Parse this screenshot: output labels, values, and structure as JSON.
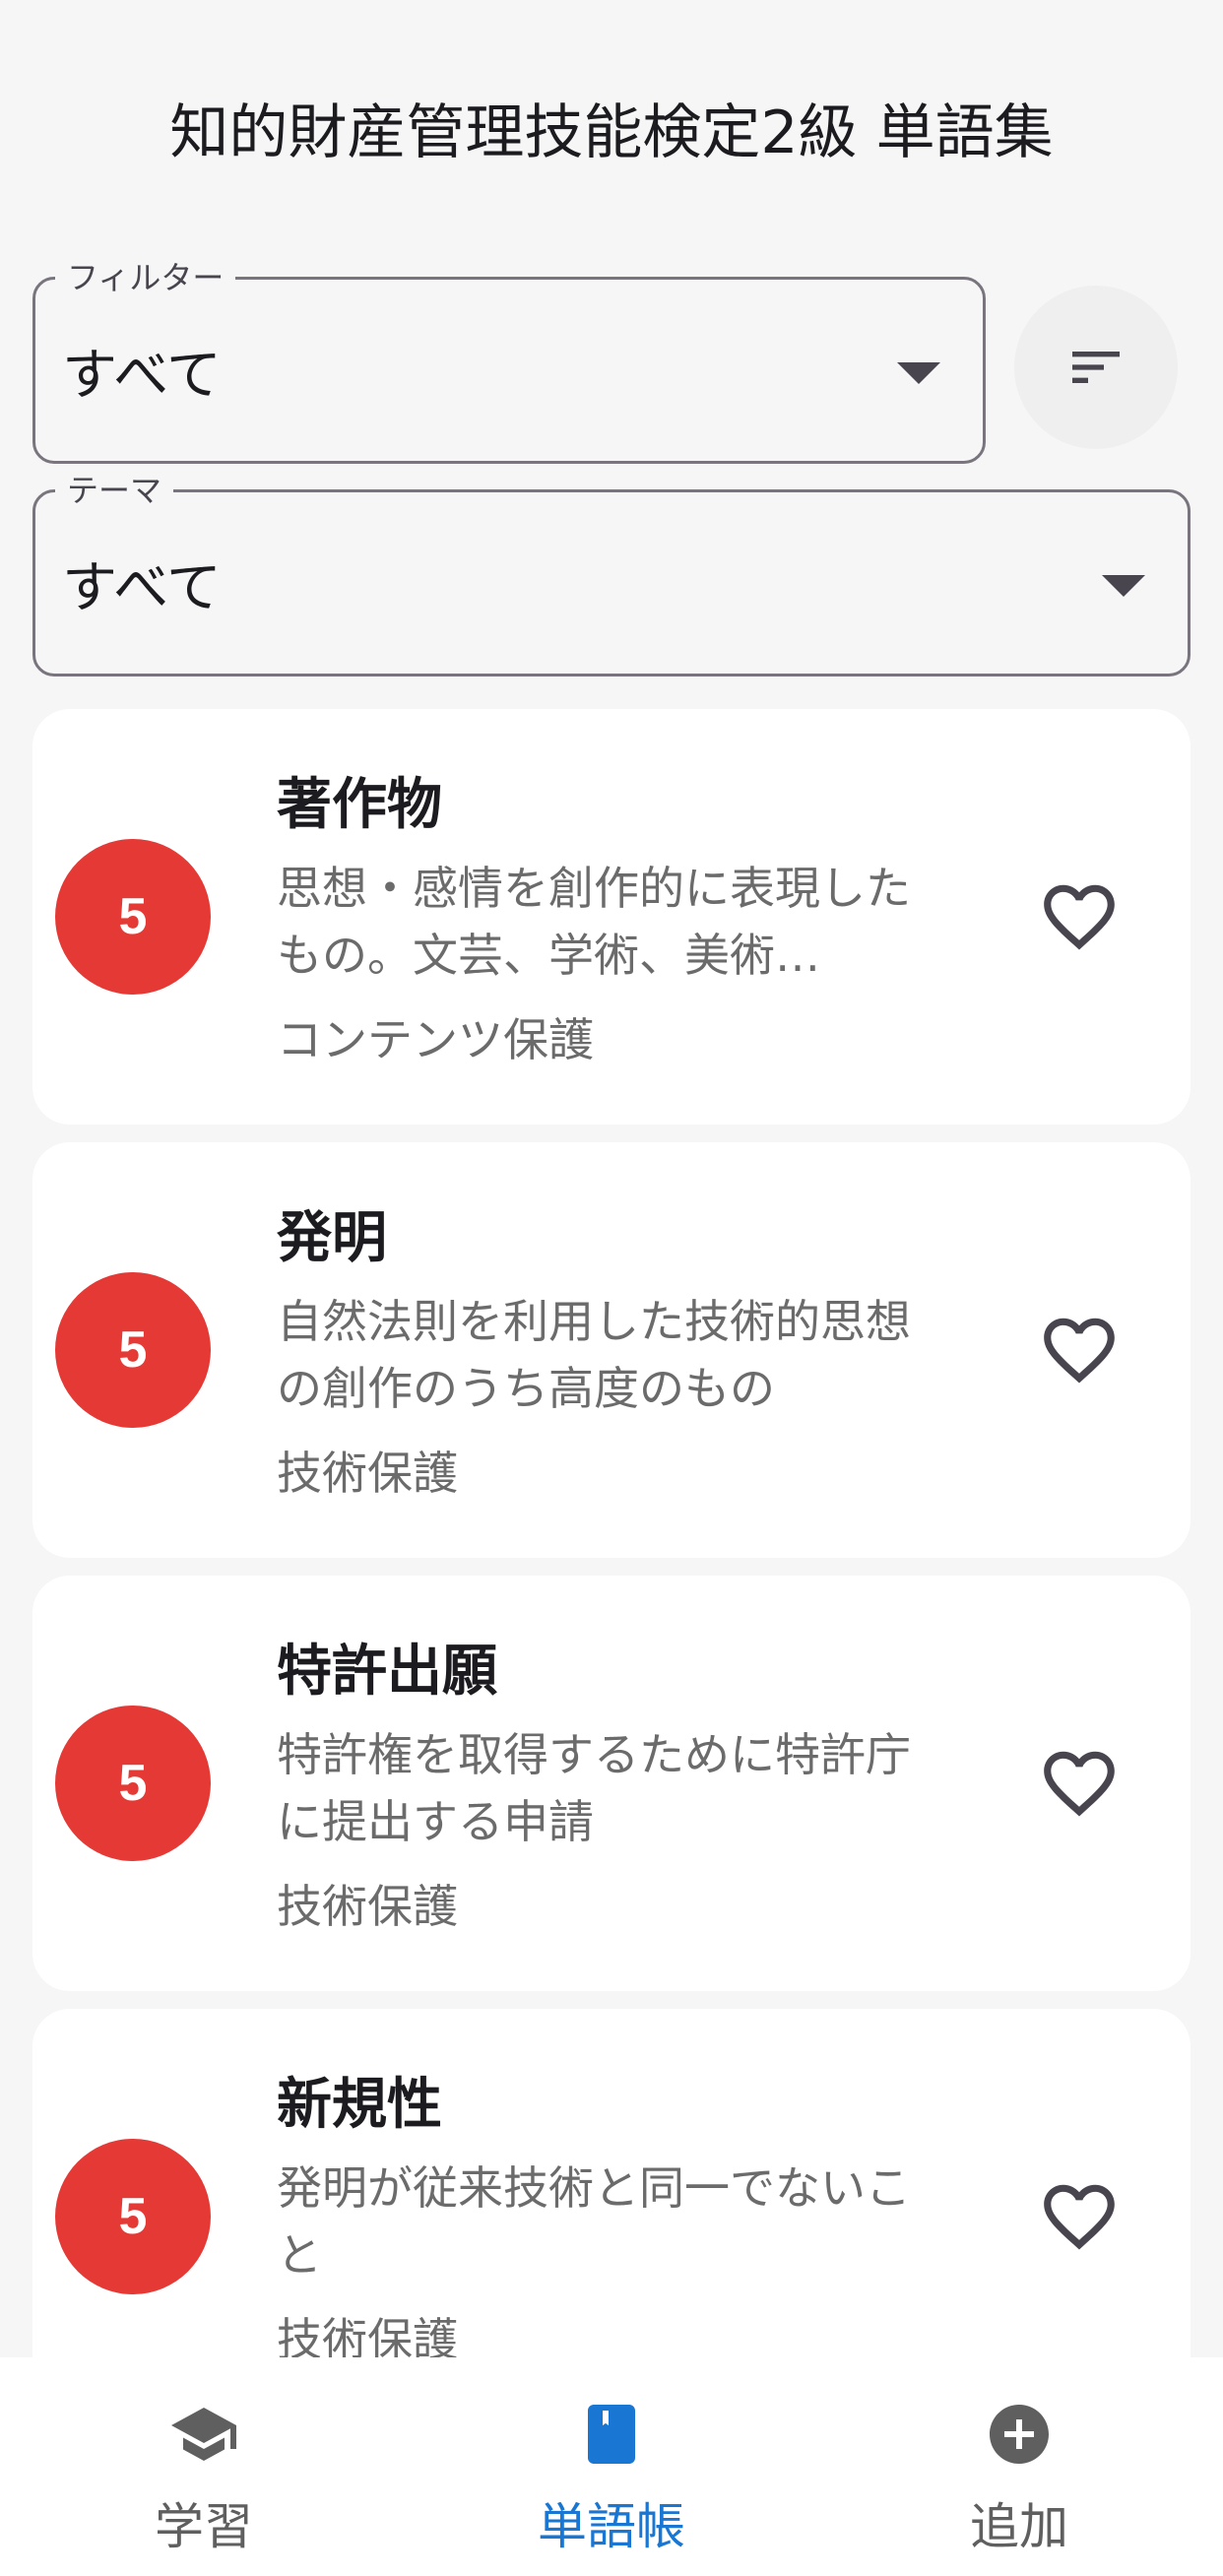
{
  "app": {
    "title": "知的財産管理技能検定2級 単語集"
  },
  "filters": {
    "filter": {
      "label": "フィルター",
      "value": "すべて"
    },
    "theme": {
      "label": "テーマ",
      "value": "すべて"
    }
  },
  "terms": [
    {
      "level": "5",
      "term": "著作物",
      "description": "思想・感情を創作的に表現したもの。文芸、学術、美術…",
      "category": "コンテンツ保護",
      "favorite": false
    },
    {
      "level": "5",
      "term": "発明",
      "description": "自然法則を利用した技術的思想の創作のうち高度のもの",
      "category": "技術保護",
      "favorite": false
    },
    {
      "level": "5",
      "term": "特許出願",
      "description": "特許権を取得するために特許庁に提出する申請",
      "category": "技術保護",
      "favorite": false
    },
    {
      "level": "5",
      "term": "新規性",
      "description": "発明が従来技術と同一でないこと",
      "category": "技術保護",
      "favorite": false
    }
  ],
  "nav": {
    "study": "学習",
    "wordbook": "単語帳",
    "add": "追加",
    "active": "wordbook"
  },
  "colors": {
    "badge": "#e53935",
    "accent": "#1976d2",
    "background": "#f6f6f6"
  }
}
